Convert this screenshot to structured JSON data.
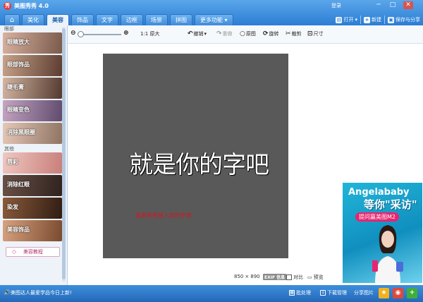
{
  "window": {
    "title": "美图秀秀 4.0",
    "login": "登录",
    "controls": [
      "─",
      "□",
      "✕"
    ]
  },
  "tabs": [
    {
      "label": "⌂",
      "kind": "home"
    },
    {
      "label": "美化"
    },
    {
      "label": "美容",
      "active": true
    },
    {
      "label": "饰品"
    },
    {
      "label": "文字"
    },
    {
      "label": "边框"
    },
    {
      "label": "场景"
    },
    {
      "label": "拼图"
    },
    {
      "label": "更多功能 ▾"
    }
  ],
  "top_actions": {
    "open": "打开",
    "open_arrow": "▾",
    "new": "新建",
    "save": "保存与分享"
  },
  "left_panel": {
    "section1": "眼部",
    "section2": "其他",
    "items1": [
      {
        "label": "眼睛放大",
        "color1": "#d9b1a0",
        "color2": "#7a5a4c"
      },
      {
        "label": "眼部饰品",
        "color1": "#c9a389",
        "color2": "#5b3c31"
      },
      {
        "label": "睫毛膏",
        "color1": "#d3b5a1",
        "color2": "#53392e"
      },
      {
        "label": "眼睛变色",
        "color1": "#c6a5c2",
        "color2": "#5f4b6e"
      },
      {
        "label": "消除黑眼圈",
        "color1": "#e6c8b8",
        "color2": "#8f7463"
      }
    ],
    "items2": [
      {
        "label": "唇彩",
        "color1": "#f0c7c1",
        "color2": "#c87f7a"
      },
      {
        "label": "消除红眼",
        "color1": "#6b5148",
        "color2": "#2f221e"
      },
      {
        "label": "染发",
        "color1": "#8a5a3a",
        "color2": "#2f1d13"
      },
      {
        "label": "美容饰品",
        "color1": "#d7a27f",
        "color2": "#7a4a2f"
      }
    ],
    "tutorial": "美容教程",
    "tutorial_icon": "◇"
  },
  "toolbar": {
    "zoom_out": "⊖",
    "zoom_in": "⊕",
    "original_size": "1:1 原大",
    "undo": "撤销",
    "redo": "重做",
    "original_image": "原图",
    "rotate": "旋转",
    "crop": "裁剪",
    "resize": "尺寸"
  },
  "canvas": {
    "main_text": "就是你的字吧",
    "sub_text": "美图秀秀放入您的字体"
  },
  "image_info": {
    "width": "850",
    "times": "×",
    "height": "890",
    "exif": "EXIF 信息",
    "compare": "对比",
    "preview": "预览"
  },
  "ad": {
    "line1": "Angelababy",
    "line2": "等你\"采访\"",
    "line3": "提问赢美图M2"
  },
  "status_bar": {
    "speaker": "🔊",
    "text": "美图达人最爱学品今日上新!",
    "batch": "批处理",
    "download": "下载管理",
    "share": "分享图片",
    "star": "★",
    "weibo": "◉",
    "plus": "+"
  }
}
